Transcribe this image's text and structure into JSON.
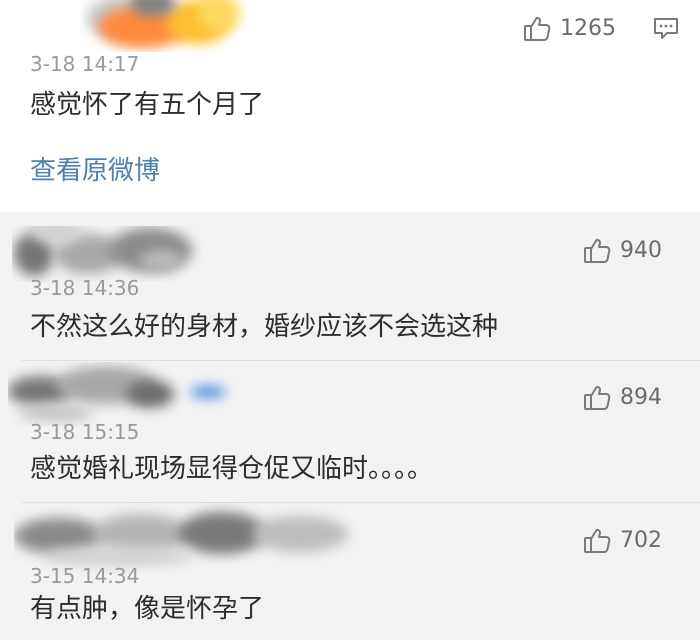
{
  "colors": {
    "background": "#ffffff",
    "reply_background": "#f2f2f2",
    "text": "#2d2d2d",
    "timestamp": "#9a9a9a",
    "link": "#4f7fb0",
    "divider": "#dedede",
    "like_count": "#6b6b6b"
  },
  "main_comment": {
    "timestamp": "3-18 14:17",
    "text": "感觉怀了有五个月了",
    "like_count": "1265",
    "like_icon": "thumbs-up-icon",
    "reply_icon": "comment-icon",
    "view_original_label": "查看原微博"
  },
  "replies": [
    {
      "timestamp": "3-18 14:36",
      "text": "不然这么好的身材，婚纱应该不会选这种",
      "like_count": "940",
      "like_icon": "thumbs-up-icon"
    },
    {
      "timestamp": "3-18 15:15",
      "text": "感觉婚礼现场显得仓促又临时。。。。",
      "like_count": "894",
      "like_icon": "thumbs-up-icon"
    },
    {
      "timestamp": "3-15 14:34",
      "text": "有点肿，像是怀孕了",
      "like_count": "702",
      "like_icon": "thumbs-up-icon"
    }
  ]
}
